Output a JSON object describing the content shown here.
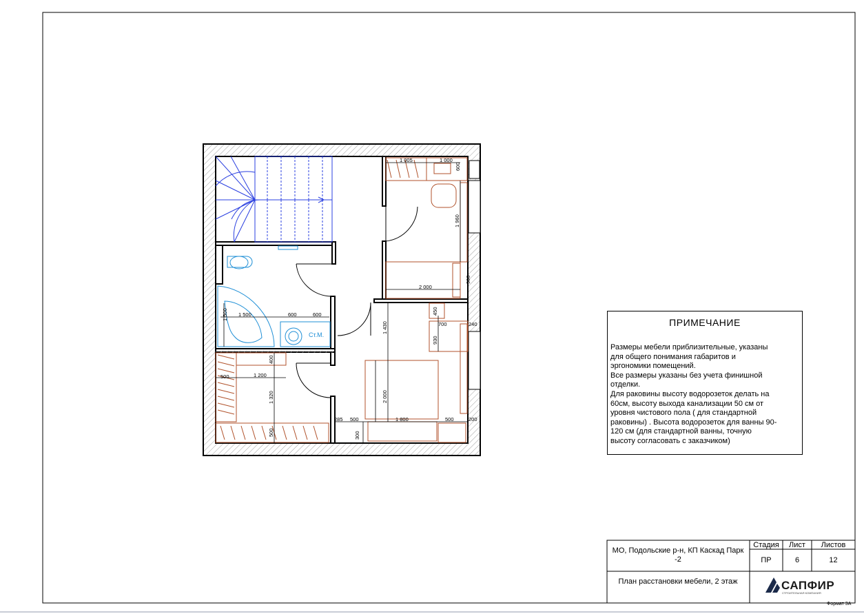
{
  "note": {
    "title": "ПРИМЕЧАНИЕ",
    "text": "  Размеры мебели приблизительные, указаны\nдля общего понимания габаритов и\nэргономики помещений.\n  Все размеры указаны без учета финишной\nотделки.\n   Для раковины высоту  водорозеток делать на\n60см,  высоту выхода канализации 50 см от\nуровня чистового пола ( для стандартной\nраковины) . Высота водорозеток для ванны 90-\n120 см (для стандартной ванны, точную\nвысоту согласовать с заказчиком)"
  },
  "title_block": {
    "address": "МО, Подольские р-н, КП Каскад Парк -2",
    "sheet_title": "План расстановки мебели, 2 этаж",
    "stage_header": "Стадия",
    "sheet_header": "Лист",
    "sheets_header": "Листов",
    "stage": "ПР",
    "sheet": "6",
    "sheets": "12",
    "company": "САПФИР",
    "company_sub": "СТРОИТЕЛЬНАЯ КОМПАНИЯ",
    "format": "Формат 3А"
  },
  "plan": {
    "dim_1005": "1 005",
    "dim_1000": "1 000",
    "dim_600_top": "600",
    "dim_1960": "1 960",
    "dim_900_desk": "900",
    "dim_2000_bed1": "2 000",
    "dim_1500": "1 500",
    "dim_600_a": "600",
    "dim_600_b": "600",
    "dim_1500_v": "1 500",
    "label_stm": "Ст.М.",
    "dim_450": "450",
    "dim_700": "700",
    "dim_240": "240",
    "dim_1430": "1 430",
    "dim_930": "930",
    "dim_400": "400",
    "dim_500_left": "500",
    "dim_1200": "1 200",
    "dim_1320": "1 320",
    "dim_2000_bed2": "2 000",
    "dim_285": "285",
    "dim_500_a": "500",
    "dim_1800": "1 800",
    "dim_500_b": "500",
    "dim_200": "200",
    "dim_300": "300",
    "dim_500_v": "500"
  },
  "colors": {
    "wall": "#000000",
    "hatch": "#9a9a9a",
    "stairs": "#2a3fe0",
    "plumbing": "#1f8fd6",
    "furniture": "#b0522b",
    "dimension": "#000000"
  }
}
